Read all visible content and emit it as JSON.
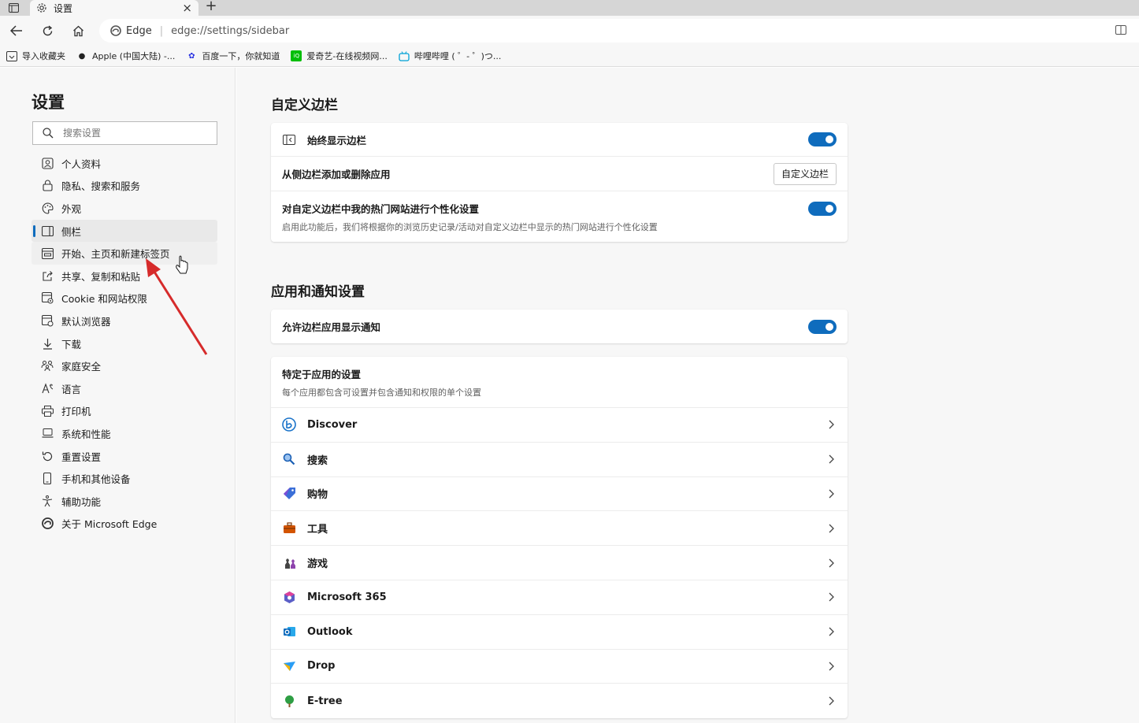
{
  "browser": {
    "tab_title": "设置",
    "address_site": "Edge",
    "address_url": "edge://settings/sidebar"
  },
  "favorites": [
    {
      "label": "导入收藏夹",
      "icon": "import-favorites-icon"
    },
    {
      "label": "Apple (中国大陆) -...",
      "icon": "apple-icon"
    },
    {
      "label": "百度一下，你就知道",
      "icon": "baidu-icon"
    },
    {
      "label": "爱奇艺-在线视频网...",
      "icon": "iqiyi-icon"
    },
    {
      "label": "哔哩哔哩 ( ゜- ゜)つ...",
      "icon": "bilibili-icon"
    }
  ],
  "settings": {
    "title": "设置",
    "search_placeholder": "搜索设置",
    "nav": [
      {
        "label": "个人资料",
        "icon": "profile-icon"
      },
      {
        "label": "隐私、搜索和服务",
        "icon": "lock-icon"
      },
      {
        "label": "外观",
        "icon": "palette-icon"
      },
      {
        "label": "侧栏",
        "icon": "sidebar-icon"
      },
      {
        "label": "开始、主页和新建标签页",
        "icon": "home-tab-icon"
      },
      {
        "label": "共享、复制和粘贴",
        "icon": "share-icon"
      },
      {
        "label": "Cookie 和网站权限",
        "icon": "cookie-icon"
      },
      {
        "label": "默认浏览器",
        "icon": "browser-icon"
      },
      {
        "label": "下载",
        "icon": "download-icon"
      },
      {
        "label": "家庭安全",
        "icon": "family-icon"
      },
      {
        "label": "语言",
        "icon": "language-icon"
      },
      {
        "label": "打印机",
        "icon": "printer-icon"
      },
      {
        "label": "系统和性能",
        "icon": "laptop-icon"
      },
      {
        "label": "重置设置",
        "icon": "reset-icon"
      },
      {
        "label": "手机和其他设备",
        "icon": "phone-icon"
      },
      {
        "label": "辅助功能",
        "icon": "accessibility-icon"
      },
      {
        "label": "关于 Microsoft Edge",
        "icon": "edge-logo-icon"
      }
    ]
  },
  "main": {
    "customize_section_title": "自定义边栏",
    "always_show_label": "始终显示边栏",
    "add_remove_label": "从侧边栏添加或删除应用",
    "customize_button": "自定义边栏",
    "personalize_label": "对自定义边栏中我的热门网站进行个性化设置",
    "personalize_desc": "启用此功能后，我们将根据你的浏览历史记录/活动对自定义边栏中显示的热门网站进行个性化设置",
    "notify_section_title": "应用和通知设置",
    "allow_notify_label": "允许边栏应用显示通知",
    "app_specific_title": "特定于应用的设置",
    "app_specific_desc": "每个应用都包含可设置并包含通知和权限的单个设置",
    "apps": [
      {
        "label": "Discover",
        "icon": "discover-icon",
        "color": "#1a73c9"
      },
      {
        "label": "搜索",
        "icon": "search-icon",
        "color": "#1a5fb4"
      },
      {
        "label": "购物",
        "icon": "shopping-tag-icon",
        "color": "#3b6fd8"
      },
      {
        "label": "工具",
        "icon": "toolbox-icon",
        "color": "#c0392b"
      },
      {
        "label": "游戏",
        "icon": "game-icon",
        "color": "#8e44ad"
      },
      {
        "label": "Microsoft 365",
        "icon": "m365-icon",
        "color": "#5b5fc7"
      },
      {
        "label": "Outlook",
        "icon": "outlook-icon",
        "color": "#0f6cbd"
      },
      {
        "label": "Drop",
        "icon": "drop-icon",
        "color": "#2a9df4"
      },
      {
        "label": "E-tree",
        "icon": "tree-icon",
        "color": "#2e9e44"
      }
    ]
  },
  "colors": {
    "accent": "#0f6cbd",
    "annotation_arrow": "#d62b2b"
  }
}
